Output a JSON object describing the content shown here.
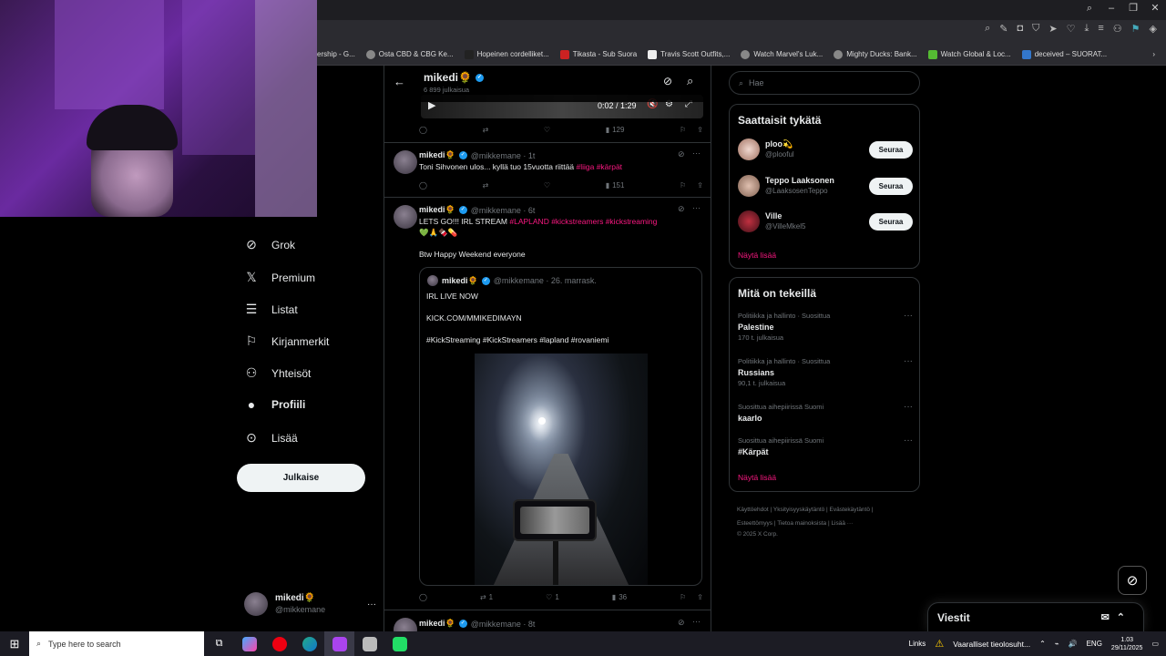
{
  "bookmarks": [
    {
      "label": "ership - G..."
    },
    {
      "label": "Osta CBD & CBG Ke..."
    },
    {
      "label": "Hopeinen cordelliket..."
    },
    {
      "label": "Tikasta - Sub Suora"
    },
    {
      "label": "Travis Scott Outfits,..."
    },
    {
      "label": "Watch Marvel's Luk..."
    },
    {
      "label": "Mighty Ducks: Bank..."
    },
    {
      "label": "Watch Global & Loc..."
    },
    {
      "label": "deceived – SUORAT..."
    }
  ],
  "nav": {
    "items": [
      {
        "label": "Grok",
        "icon": "grok-icon"
      },
      {
        "label": "Premium",
        "icon": "x-logo-icon"
      },
      {
        "label": "Listat",
        "icon": "list-icon"
      },
      {
        "label": "Kirjanmerkit",
        "icon": "bookmark-icon"
      },
      {
        "label": "Yhteisöt",
        "icon": "communities-icon"
      },
      {
        "label": "Profiili",
        "icon": "profile-icon"
      },
      {
        "label": "Lisää",
        "icon": "more-circle-icon"
      }
    ],
    "post_label": "Julkaise",
    "account_name": "mikedi🌻",
    "account_handle": "@mikkemane"
  },
  "feed": {
    "header_name": "mikedi🌻",
    "header_count": "6 899 julkaisua",
    "video_time": "0:02 / 1:29",
    "top_actions": {
      "views": "129"
    },
    "tweets": [
      {
        "name": "mikedi🌻",
        "meta": "@mikkemane · 1t",
        "text": "Toni Sihvonen ulos... kyllä tuo 15vuotta riittää",
        "tags": "#liiga #kärpät",
        "retweets": "",
        "likes": "",
        "views": "151"
      },
      {
        "name": "mikedi🌻",
        "meta": "@mikkemane · 6t",
        "text": "LETS GO!!! IRL STREAM",
        "tags": "#LAPLAND #kickstreamers #kickstreaming",
        "emoji_line": "💚🙏🍫💊",
        "text2": "Btw Happy Weekend everyone",
        "quote_name": "mikedi🌻",
        "quote_meta": "@mikkemane · 26. marrask.",
        "quote_line1": "IRL LIVE NOW",
        "quote_line2": "KICK.COM/MMIKEDIMAYN",
        "quote_line3": "#KickStreaming #KickStreamers #lapland #rovaniemi",
        "retweets": "1",
        "likes": "1",
        "views": "36"
      },
      {
        "name": "mikedi🌻",
        "meta": "@mikkemane · 8t"
      }
    ]
  },
  "right": {
    "search_placeholder": "Hae",
    "suggest_title": "Saattaisit tykätä",
    "suggestions": [
      {
        "name": "ploo💫",
        "handle": "@plooful",
        "button": "Seuraa"
      },
      {
        "name": "Teppo Laaksonen",
        "handle": "@LaaksosenTeppo",
        "button": "Seuraa"
      },
      {
        "name": "Ville",
        "handle": "@VilleMkel5",
        "button": "Seuraa"
      }
    ],
    "suggest_more": "Näytä lisää",
    "trends_title": "Mitä on tekeillä",
    "trends": [
      {
        "context": "Politiikka ja hallinto · Suosittua",
        "topic": "Palestine",
        "count": "170 t. julkaisua"
      },
      {
        "context": "Politiikka ja hallinto · Suosittua",
        "topic": "Russians",
        "count": "90,1 t. julkaisua"
      },
      {
        "context": "Suosittua aihepiirissä Suomi",
        "topic": "kaarlo",
        "count": ""
      },
      {
        "context": "Suosittua aihepiirissä Suomi",
        "topic": "#Kärpät",
        "count": ""
      }
    ],
    "trends_more": "Näytä lisää",
    "footer_line1": "Käyttöehdot | Yksityisyyskäytäntö | Evästekäytäntö |",
    "footer_line2": "Esteettömyys | Tietoa mainoksista | Lisää ···",
    "footer_line3": "© 2025 X Corp."
  },
  "messages_label": "Viestit",
  "taskbar": {
    "search_placeholder": "Type here to search",
    "links": "Links",
    "alert": "Vaaralliset tieolosuht...",
    "lang": "ENG",
    "time": "1.03",
    "date": "29/11/2025"
  },
  "colors": {
    "accent_pink": "#f91880",
    "verified_blue": "#1d9bf0",
    "bg": "#000000"
  }
}
